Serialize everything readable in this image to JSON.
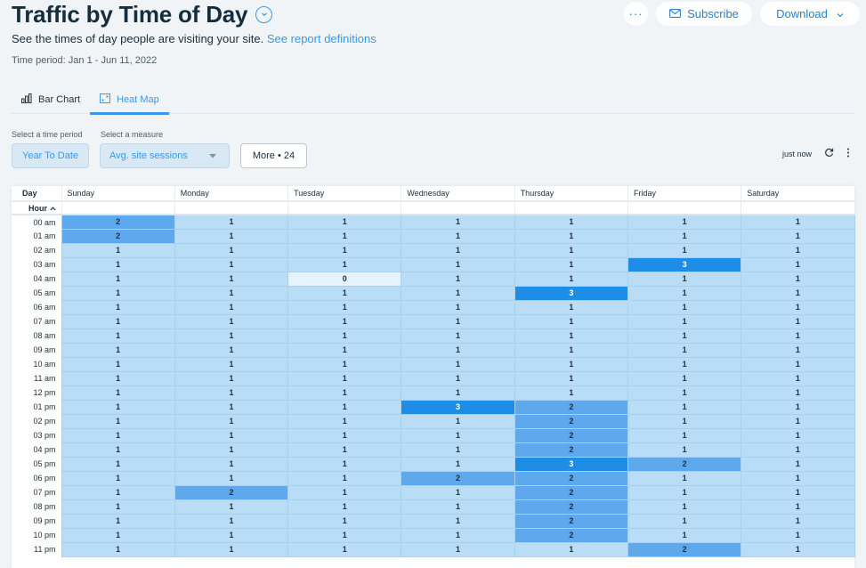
{
  "header": {
    "title": "Traffic by Time of Day",
    "subtitle": "See the times of day people are visiting your site.",
    "definitions_link": "See report definitions",
    "time_period": "Time period: Jan 1 - Jun 11, 2022",
    "more_actions": "···",
    "subscribe_label": "Subscribe",
    "download_label": "Download"
  },
  "tabs": [
    {
      "label": "Bar Chart",
      "icon": "bar-chart-icon",
      "active": false
    },
    {
      "label": "Heat Map",
      "icon": "heat-map-icon",
      "active": true
    }
  ],
  "controls": {
    "time_period_label": "Select a time period",
    "time_period_value": "Year To Date",
    "measure_label": "Select a measure",
    "measure_value": "Avg. site sessions",
    "more_label": "More • 24",
    "updated": "just now"
  },
  "colors": {
    "accent": "#3899ec",
    "level_0": "#e6f3fc",
    "level_1": "#b9dcf7",
    "level_2": "#5ea8ed",
    "level_3": "#1e8de6"
  },
  "table": {
    "day_header": "Day",
    "hour_header": "Hour",
    "days": [
      "Sunday",
      "Monday",
      "Tuesday",
      "Wednesday",
      "Thursday",
      "Friday",
      "Saturday"
    ],
    "rows": [
      {
        "hour": "00 am",
        "values": [
          2,
          1,
          1,
          1,
          1,
          1,
          1
        ]
      },
      {
        "hour": "01 am",
        "values": [
          2,
          1,
          1,
          1,
          1,
          1,
          1
        ]
      },
      {
        "hour": "02 am",
        "values": [
          1,
          1,
          1,
          1,
          1,
          1,
          1
        ]
      },
      {
        "hour": "03 am",
        "values": [
          1,
          1,
          1,
          1,
          1,
          3,
          1
        ]
      },
      {
        "hour": "04 am",
        "values": [
          1,
          1,
          0,
          1,
          1,
          1,
          1
        ]
      },
      {
        "hour": "05 am",
        "values": [
          1,
          1,
          1,
          1,
          3,
          1,
          1
        ]
      },
      {
        "hour": "06 am",
        "values": [
          1,
          1,
          1,
          1,
          1,
          1,
          1
        ]
      },
      {
        "hour": "07 am",
        "values": [
          1,
          1,
          1,
          1,
          1,
          1,
          1
        ]
      },
      {
        "hour": "08 am",
        "values": [
          1,
          1,
          1,
          1,
          1,
          1,
          1
        ]
      },
      {
        "hour": "09 am",
        "values": [
          1,
          1,
          1,
          1,
          1,
          1,
          1
        ]
      },
      {
        "hour": "10 am",
        "values": [
          1,
          1,
          1,
          1,
          1,
          1,
          1
        ]
      },
      {
        "hour": "11 am",
        "values": [
          1,
          1,
          1,
          1,
          1,
          1,
          1
        ]
      },
      {
        "hour": "12 pm",
        "values": [
          1,
          1,
          1,
          1,
          1,
          1,
          1
        ]
      },
      {
        "hour": "01 pm",
        "values": [
          1,
          1,
          1,
          3,
          2,
          1,
          1
        ]
      },
      {
        "hour": "02 pm",
        "values": [
          1,
          1,
          1,
          1,
          2,
          1,
          1
        ]
      },
      {
        "hour": "03 pm",
        "values": [
          1,
          1,
          1,
          1,
          2,
          1,
          1
        ]
      },
      {
        "hour": "04 pm",
        "values": [
          1,
          1,
          1,
          1,
          2,
          1,
          1
        ]
      },
      {
        "hour": "05 pm",
        "values": [
          1,
          1,
          1,
          1,
          3,
          2,
          1
        ]
      },
      {
        "hour": "06 pm",
        "values": [
          1,
          1,
          1,
          2,
          2,
          1,
          1
        ]
      },
      {
        "hour": "07 pm",
        "values": [
          1,
          2,
          1,
          1,
          2,
          1,
          1
        ]
      },
      {
        "hour": "08 pm",
        "values": [
          1,
          1,
          1,
          1,
          2,
          1,
          1
        ]
      },
      {
        "hour": "09 pm",
        "values": [
          1,
          1,
          1,
          1,
          2,
          1,
          1
        ]
      },
      {
        "hour": "10 pm",
        "values": [
          1,
          1,
          1,
          1,
          2,
          1,
          1
        ]
      },
      {
        "hour": "11 pm",
        "values": [
          1,
          1,
          1,
          1,
          1,
          2,
          1
        ]
      }
    ]
  }
}
